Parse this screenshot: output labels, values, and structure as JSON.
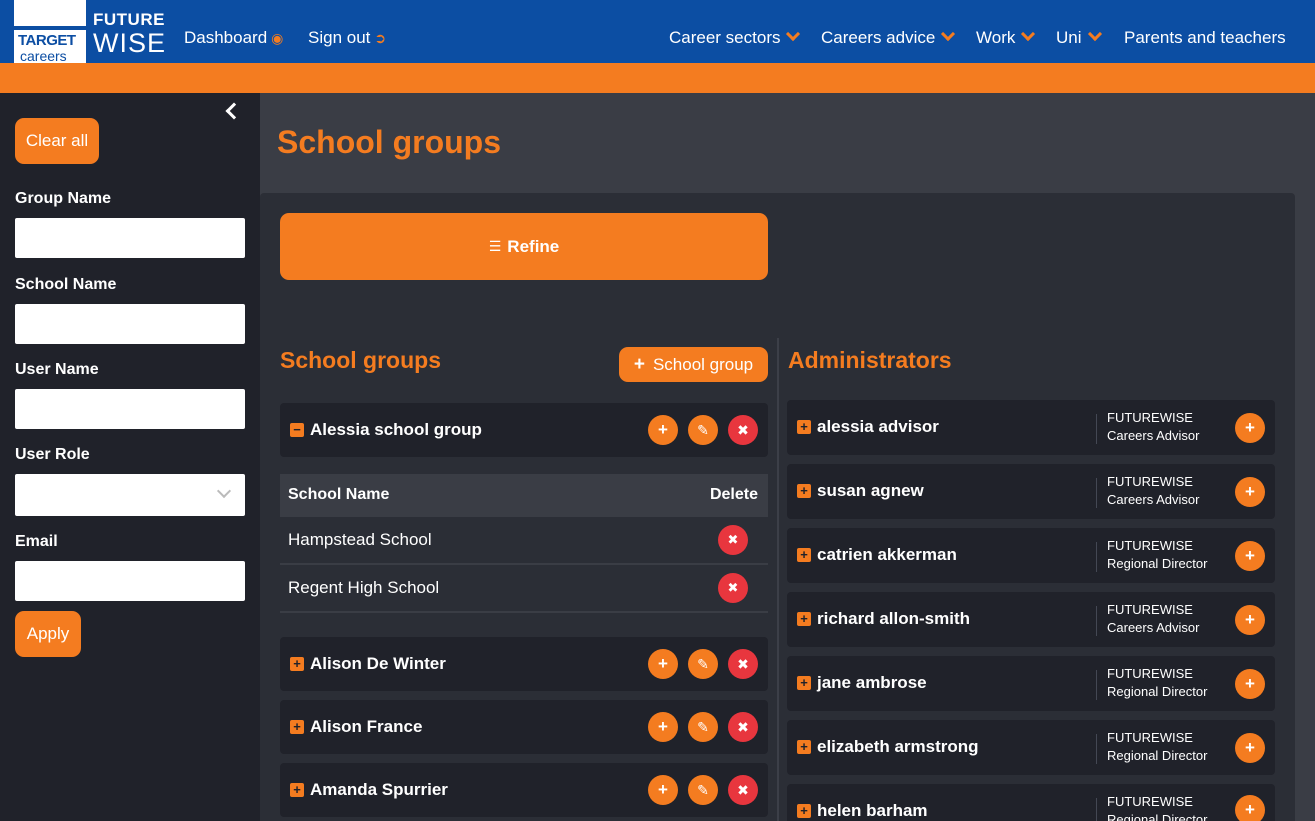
{
  "header": {
    "logo": {
      "target": "TARGET",
      "careers": "careers"
    },
    "brand": {
      "future": "FUTURE",
      "wise": "WISE"
    },
    "left_links": [
      {
        "label": "Dashboard",
        "icon": "palette-icon"
      },
      {
        "label": "Sign out",
        "icon": "sign-out-icon"
      }
    ],
    "right_links": [
      {
        "label": "Career sectors",
        "has_dropdown": true
      },
      {
        "label": "Careers advice",
        "has_dropdown": true
      },
      {
        "label": "Work",
        "has_dropdown": true
      },
      {
        "label": "Uni",
        "has_dropdown": true
      },
      {
        "label": "Parents and teachers",
        "has_dropdown": false
      }
    ],
    "colors": {
      "nav": "#0c4ea3",
      "accent": "#f47c20"
    }
  },
  "sidebar": {
    "clear_label": "Clear all",
    "fields": [
      {
        "label": "Group Name",
        "value": ""
      },
      {
        "label": "School Name",
        "value": ""
      },
      {
        "label": "User Name",
        "value": ""
      },
      {
        "label": "User Role",
        "value": ""
      },
      {
        "label": "Email",
        "value": ""
      }
    ],
    "apply_label": "Apply"
  },
  "main": {
    "title": "School groups",
    "refine_label": "Refine",
    "groups_title": "School groups",
    "add_group_label": "School group",
    "groups": [
      {
        "name": "Alessia school group",
        "expanded": true
      },
      {
        "name": "Alison De Winter",
        "expanded": false
      },
      {
        "name": "Alison France",
        "expanded": false
      },
      {
        "name": "Amanda Spurrier",
        "expanded": false
      }
    ],
    "schools_table": {
      "headers": [
        "School Name",
        "Delete"
      ],
      "rows": [
        "Hampstead School",
        "Regent High School"
      ]
    },
    "admins_title": "Administrators",
    "admins": [
      {
        "name": "alessia advisor",
        "org": "FUTUREWISE",
        "role": "Careers Advisor"
      },
      {
        "name": "susan agnew",
        "org": "FUTUREWISE",
        "role": "Careers Advisor"
      },
      {
        "name": "catrien akkerman",
        "org": "FUTUREWISE",
        "role": "Regional Director"
      },
      {
        "name": "richard allon-smith",
        "org": "FUTUREWISE",
        "role": "Careers Advisor"
      },
      {
        "name": "jane ambrose",
        "org": "FUTUREWISE",
        "role": "Regional Director"
      },
      {
        "name": "elizabeth armstrong",
        "org": "FUTUREWISE",
        "role": "Regional Director"
      },
      {
        "name": "helen barham",
        "org": "FUTUREWISE",
        "role": "Regional Director"
      }
    ]
  }
}
